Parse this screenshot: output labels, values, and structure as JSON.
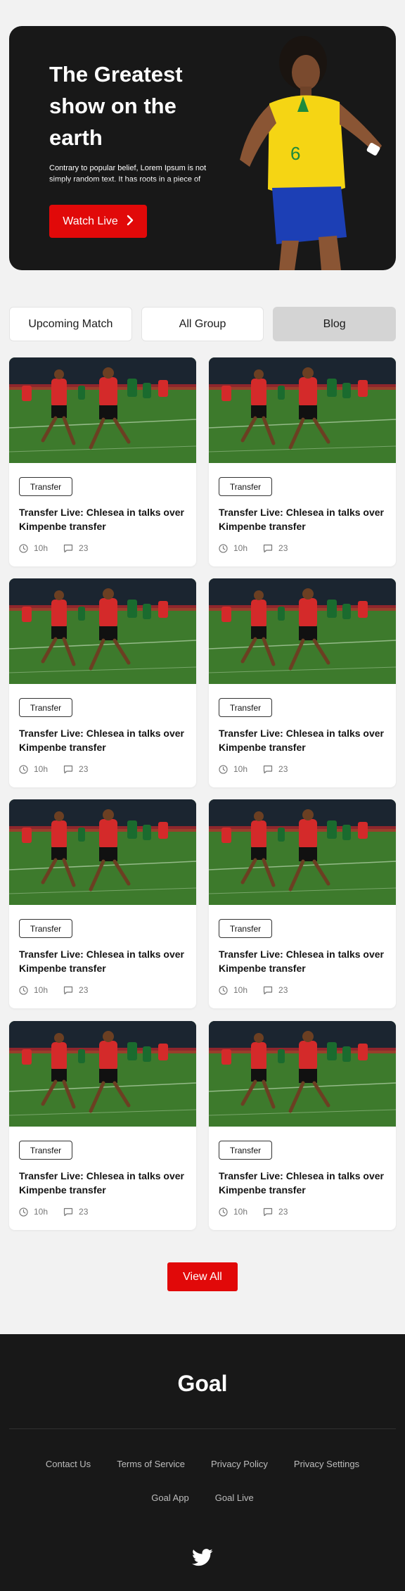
{
  "hero": {
    "title": "The Greatest show on the earth",
    "text": "Contrary to popular belief, Lorem Ipsum is not simply random text. It has roots in a piece of classical Latin literature from",
    "button_label": "Watch Live",
    "accent_color": "#e10909"
  },
  "tabs": [
    {
      "label": "Upcoming Match",
      "active": false
    },
    {
      "label": "All Group",
      "active": false
    },
    {
      "label": "Blog",
      "active": true
    }
  ],
  "cards": [
    {
      "tag": "Transfer",
      "title": "Transfer Live: Chlesea in talks over Kimpenbe transfer",
      "time": "10h",
      "comments": "23"
    },
    {
      "tag": "Transfer",
      "title": "Transfer Live: Chlesea in talks over Kimpenbe transfer",
      "time": "10h",
      "comments": "23"
    },
    {
      "tag": "Transfer",
      "title": "Transfer Live: Chlesea in talks over Kimpenbe transfer",
      "time": "10h",
      "comments": "23"
    },
    {
      "tag": "Transfer",
      "title": "Transfer Live: Chlesea in talks over Kimpenbe transfer",
      "time": "10h",
      "comments": "23"
    },
    {
      "tag": "Transfer",
      "title": "Transfer Live: Chlesea in talks over Kimpenbe transfer",
      "time": "10h",
      "comments": "23"
    },
    {
      "tag": "Transfer",
      "title": "Transfer Live: Chlesea in talks over Kimpenbe transfer",
      "time": "10h",
      "comments": "23"
    },
    {
      "tag": "Transfer",
      "title": "Transfer Live: Chlesea in talks over Kimpenbe transfer",
      "time": "10h",
      "comments": "23"
    },
    {
      "tag": "Transfer",
      "title": "Transfer Live: Chlesea in talks over Kimpenbe transfer",
      "time": "10h",
      "comments": "23"
    }
  ],
  "view_all_label": "View All",
  "footer": {
    "logo": "Goal",
    "links_row1": [
      "Contact Us",
      "Terms of Service",
      "Privacy Policy",
      "Privacy Settings"
    ],
    "links_row2": [
      "Goal App",
      "Goal Live"
    ],
    "social_icon": "twitter-icon"
  }
}
